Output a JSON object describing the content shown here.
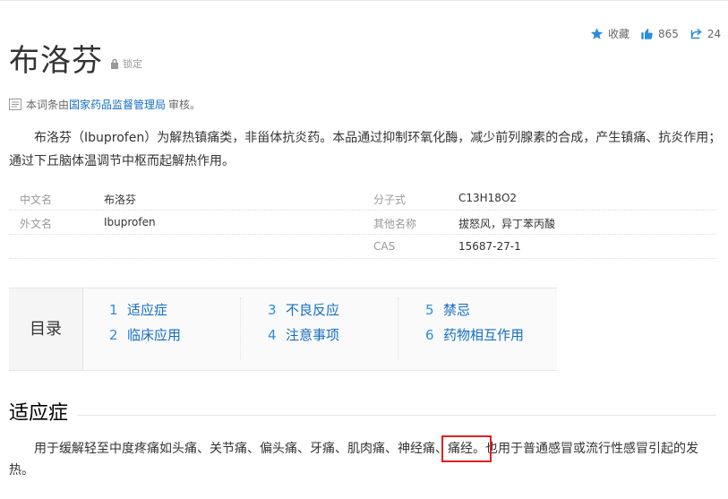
{
  "header": {
    "title": "布洛芬",
    "lock_label": "锁定"
  },
  "actions": {
    "favorite": "收藏",
    "like_count": "865",
    "share_count": "24"
  },
  "review": {
    "prefix": "本词条由",
    "link": "国家药品监督管理局",
    "suffix": "审核"
  },
  "summary": "布洛芬（Ibuprofen）为解热镇痛类，非甾体抗炎药。本品通过抑制环氧化酶，减少前列腺素的合成，产生镇痛、抗炎作用；通过下丘脑体温调节中枢而起解热作用。",
  "basic_info": {
    "left": [
      {
        "key": "中文名",
        "value": "布洛芬"
      },
      {
        "key": "外文名",
        "value": "Ibuprofen"
      }
    ],
    "right": [
      {
        "key": "分子式",
        "value": "C13H18O2"
      },
      {
        "key": "其他名称",
        "value": "拔怒风，异丁苯丙酸"
      },
      {
        "key": "CAS",
        "value": "15687-27-1"
      }
    ]
  },
  "toc": {
    "label": "目录",
    "items": [
      {
        "num": "1",
        "label": "适应症"
      },
      {
        "num": "2",
        "label": "临床应用"
      },
      {
        "num": "3",
        "label": "不良反应"
      },
      {
        "num": "4",
        "label": "注意事项"
      },
      {
        "num": "5",
        "label": "禁忌"
      },
      {
        "num": "6",
        "label": "药物相互作用"
      }
    ]
  },
  "section": {
    "title": "适应症",
    "text_before": "用于缓解轻至中度疼痛如头痛、关节痛、偏头痛、牙痛、肌肉痛、神经痛、",
    "highlight": "痛经。",
    "text_after": "也用于普通感冒或流行性感冒引起的发热。"
  },
  "colors": {
    "link": "#136ec2",
    "highlight_box": "#e02020",
    "icon": "#2b8de0"
  }
}
